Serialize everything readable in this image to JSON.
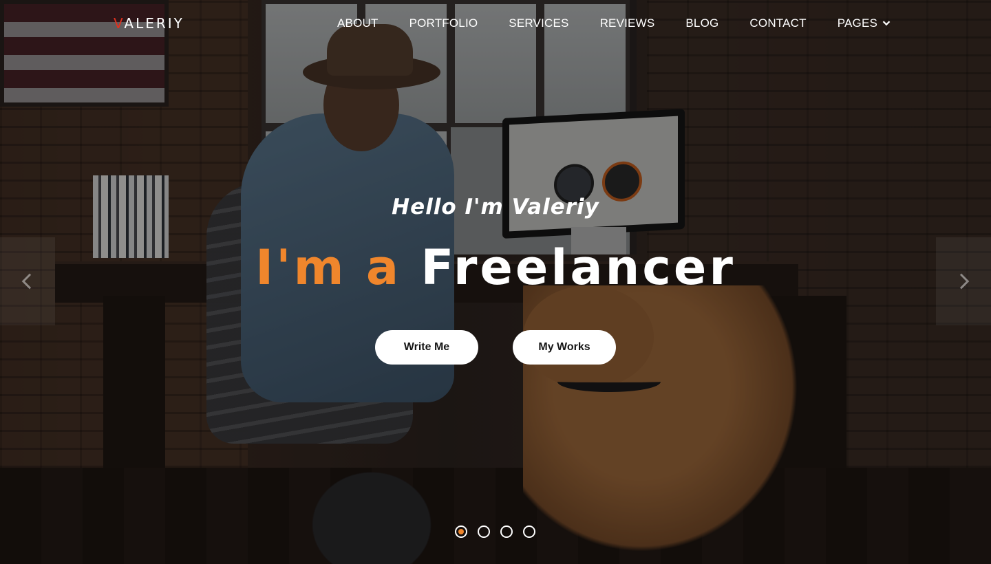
{
  "brand": {
    "logo_accent_letter": "V",
    "logo_rest": "ALERIY",
    "accent_color": "#e0311f"
  },
  "nav": {
    "items": [
      {
        "label": "ABOUT"
      },
      {
        "label": "PORTFOLIO"
      },
      {
        "label": "SERVICES"
      },
      {
        "label": "REVIEWS"
      },
      {
        "label": "BLOG"
      },
      {
        "label": "CONTACT"
      },
      {
        "label": "PAGES",
        "icon": "chevron-down-icon"
      }
    ]
  },
  "hero": {
    "greeting": "Hello I'm Valeriy",
    "headline_prefix": "I'm a",
    "headline_role": "Freelancer",
    "highlight_color": "#f0862c",
    "buttons": {
      "primary": "Write Me",
      "secondary": "My Works"
    }
  },
  "slider": {
    "prev_icon": "chevron-left-icon",
    "next_icon": "chevron-right-icon",
    "slide_count": 4,
    "active_slide": 1
  }
}
